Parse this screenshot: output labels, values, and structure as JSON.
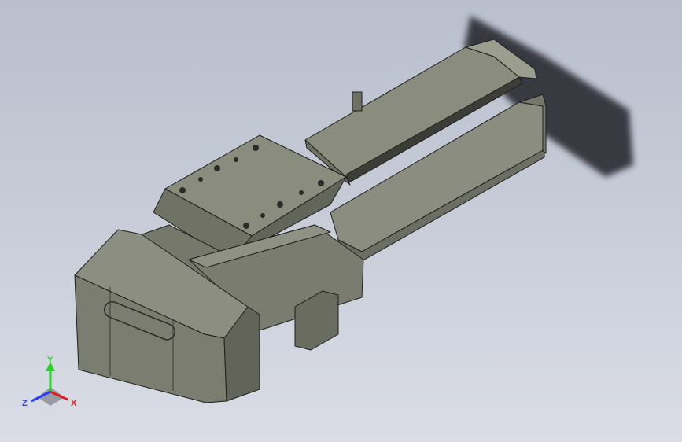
{
  "viewport": {
    "background_top": "#b9bfcd",
    "background_bottom": "#dadde5"
  },
  "model": {
    "name_icon": "linear-actuator-model",
    "body_color": "#7d7f72",
    "shadow_color": "#2a2c30"
  },
  "triad": {
    "y_label": "Y",
    "x_label": "X",
    "z_label": "Z",
    "y_color": "#2bd12b",
    "x_color": "#e02020",
    "z_color": "#2a3cff"
  }
}
